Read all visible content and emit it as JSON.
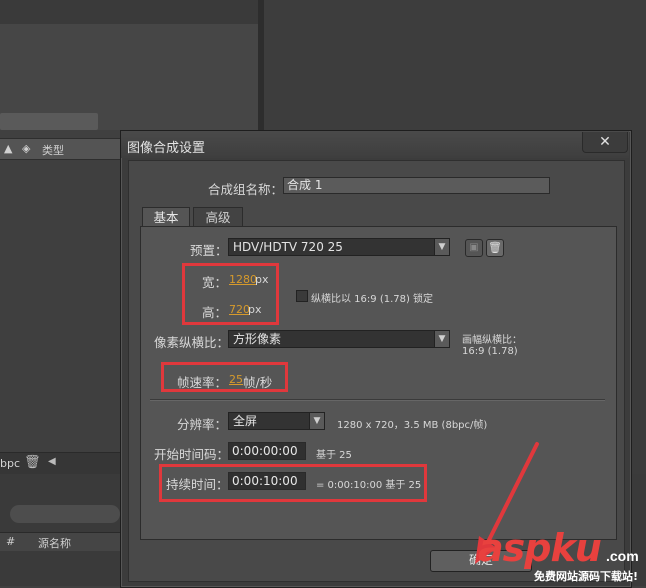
{
  "background": {
    "project_column_label": "类型",
    "bpc_label": "bpc",
    "timeline_column_hash": "#",
    "timeline_column_source": "源名称"
  },
  "dialog": {
    "title": "图像合成设置",
    "close_symbol": "✕",
    "comp_name_label": "合成组名称：",
    "comp_name_value": "合成 1",
    "tabs": [
      {
        "label": "基本",
        "active": true
      },
      {
        "label": "高级",
        "active": false
      }
    ],
    "preset": {
      "label": "预置：",
      "value": "HDV/HDTV 720 25"
    },
    "width": {
      "label": "宽：",
      "value": "1280",
      "unit": "px"
    },
    "height": {
      "label": "高：",
      "value": "720",
      "unit": "px"
    },
    "lock_aspect_label": "纵横比以 16:9 (1.78) 锁定",
    "lock_aspect_checked": false,
    "pixel_aspect": {
      "label": "像素纵横比：",
      "value": "方形像素",
      "frame_aspect_label": "画幅纵横比：",
      "frame_aspect_value": "16:9 (1.78)"
    },
    "frame_rate": {
      "label": "帧速率：",
      "value": "25",
      "unit": "帧/秒"
    },
    "resolution": {
      "label": "分辨率：",
      "value": "全屏",
      "info": "1280 x 720，3.5 MB (8bpc/帧)"
    },
    "start_timecode": {
      "label": "开始时间码：",
      "value": "0:00:00:00",
      "base": "基于 25"
    },
    "duration": {
      "label": "持续时间：",
      "value": "0:00:10:00",
      "info": "= 0:00:10:00  基于 25"
    },
    "ok_button": "确定"
  },
  "watermark": {
    "brand": "aspku",
    "tld": ".com",
    "subtitle": "免费网站源码下载站!"
  },
  "colors": {
    "highlight_box": "#e0383c",
    "value_orange": "#d69a2c",
    "dialog_bg": "#494949"
  }
}
